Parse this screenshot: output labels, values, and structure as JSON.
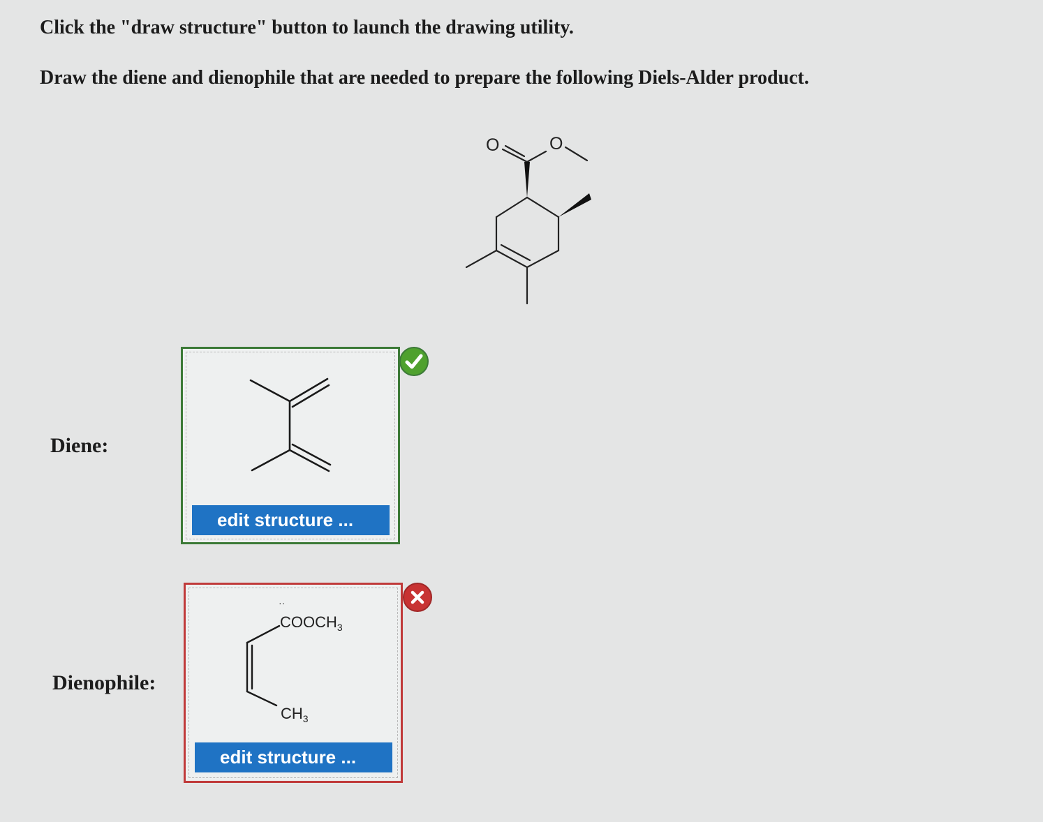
{
  "instructions": {
    "line1": "Click the \"draw structure\" button to launch the drawing utility.",
    "line2": "Draw the diene and dienophile that are needed to prepare the following Diels-Alder product."
  },
  "product": {
    "atom_o_carbonyl": "O",
    "atom_o_ester": "O"
  },
  "diene": {
    "label": "Diene:",
    "button_label": "edit structure ...",
    "status": "correct"
  },
  "dienophile": {
    "label": "Dienophile:",
    "button_label": "edit structure ...",
    "status": "incorrect",
    "group_top": "COOCH",
    "group_top_sub": "3",
    "lone_pair": "··",
    "group_bottom": "CH",
    "group_bottom_sub": "3"
  },
  "colors": {
    "correct": "#3c7a37",
    "incorrect": "#c03a3a",
    "button": "#1f73c4"
  },
  "icons": {
    "correct": "check-icon",
    "incorrect": "x-icon"
  }
}
